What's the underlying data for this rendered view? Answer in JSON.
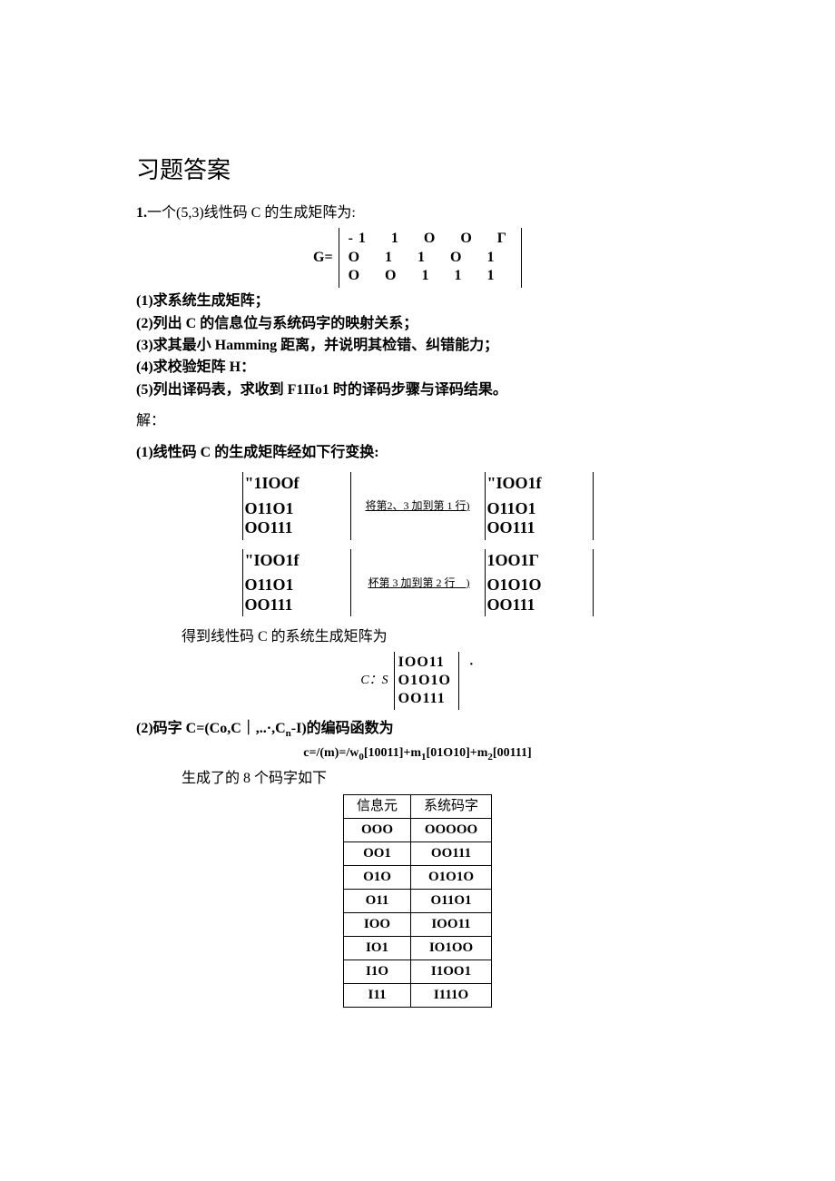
{
  "title": "习题答案",
  "problem_intro": {
    "prefix": "1.",
    "text": "一个(5,3)线性码 C 的生成矩阵为:"
  },
  "G_label": "G=",
  "G_matrix": {
    "rows": [
      "-1　1　O　O　Γ",
      "O　1　1　O　1",
      "O　O　1　1　1"
    ]
  },
  "questions": {
    "q1": "(1)求系统生成矩阵；",
    "q2": "(2)列出 C 的信息位与系统码字的映射关系；",
    "q3": "(3)求其最小 Hamming 距离，并说明其检错、纠错能力；",
    "q4": "(4)求校验矩阵 H：",
    "q5": "(5)列出译码表，求收到 F1IIo1 时的译码步骤与译码结果。"
  },
  "solution_label": "解：",
  "part1_intro": "(1)线性码 C 的生成矩阵经如下行变换:",
  "transform": {
    "m1": [
      "\"1IOOf",
      "O11O1",
      "OO111"
    ],
    "note1": "将第2、3 加到第 1 行)",
    "m2": [
      "\"IOO1f",
      "O11O1",
      "OO111"
    ],
    "m3": [
      "\"IOO1f",
      "O11O1",
      "OO111"
    ],
    "note2": "杯第 3 加到第 2 行　)",
    "m4": [
      "1OO1Γ",
      "O1O1O",
      "OO111"
    ]
  },
  "gs_intro": "得到线性码 C 的系统生成矩阵为",
  "gs_label": "C：S",
  "gs_matrix": [
    "IOO11",
    "O1O1O",
    "OO111"
  ],
  "part2_intro_a": "(2)码字 C=(Co,C｜,..·,C",
  "part2_intro_sub": "n",
  "part2_intro_b": "-I)的编码函数为",
  "formula": {
    "lhs": "c=/(m)=/w",
    "s0": "0",
    "r0": "[10011]+m",
    "s1": "1",
    "r1": "[01O10]+m",
    "s2": "2",
    "r2": "[00111]"
  },
  "table_intro": "生成了的 8 个码字如下",
  "code_table": {
    "headers": [
      "信息元",
      "系统码字"
    ],
    "rows": [
      [
        "OOO",
        "OOOOO"
      ],
      [
        "OO1",
        "OO111"
      ],
      [
        "O1O",
        "O1O1O"
      ],
      [
        "O11",
        "O11O1"
      ],
      [
        "IOO",
        "IOO11"
      ],
      [
        "IO1",
        "IO1OO"
      ],
      [
        "I1O",
        "I1OO1"
      ],
      [
        "I11",
        "I111O"
      ]
    ]
  }
}
